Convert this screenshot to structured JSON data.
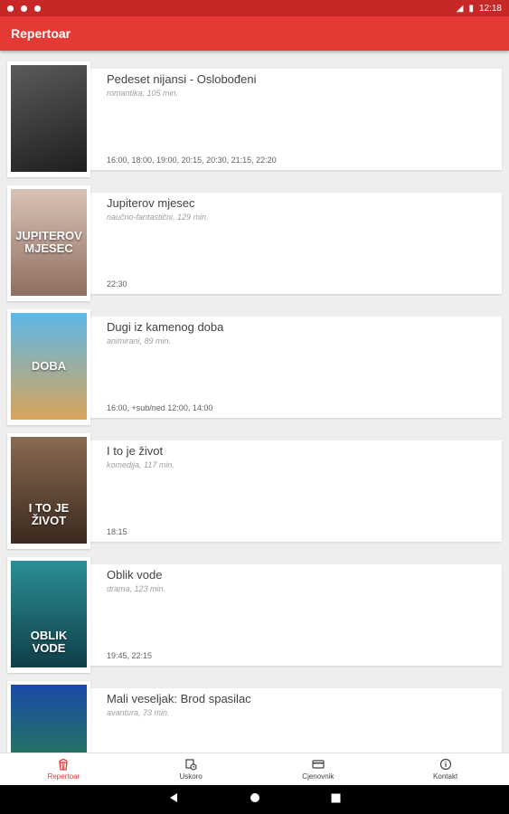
{
  "status_bar": {
    "time": "12:18"
  },
  "app_bar": {
    "title": "Repertoar"
  },
  "movies": [
    {
      "title": "Pedeset nijansi - Oslobođeni",
      "meta": "romantika, 105 min.",
      "times": "16:00, 18:00, 19:00, 20:15, 20:30, 21:15, 22:20",
      "poster_color": "#3a3a3a"
    },
    {
      "title": "Jupiterov mjesec",
      "meta": "naučno-fantastični, 129 min.",
      "times": "22:30",
      "poster_color": "#b89a8a",
      "poster_text": "JUPITEROV MJESEC"
    },
    {
      "title": "Dugi iz kamenog doba",
      "meta": "animirani, 89 min.",
      "times": "16:00, +sub/ned 12:00, 14:00",
      "poster_color": "#4aa7d8",
      "poster_text": "DOBA"
    },
    {
      "title": "I to je život",
      "meta": "komedija, 117 min.",
      "times": "18:15",
      "poster_color": "#6b4a35",
      "poster_text": "I TO JE ŽIVOT"
    },
    {
      "title": "Oblik vode",
      "meta": "drama, 123 min.",
      "times": "19:45, 22:15",
      "poster_color": "#1f6f7a",
      "poster_text": "OBLIK VODE"
    },
    {
      "title": "Mali veseljak: Brod spasilac",
      "meta": "avantura, 73 min.",
      "times": "",
      "poster_color": "#1a3d8a"
    }
  ],
  "bottom_nav": [
    {
      "label": "Repertoar",
      "icon": "popcorn-icon",
      "active": true
    },
    {
      "label": "Uskoro",
      "icon": "calendar-clock-icon",
      "active": false
    },
    {
      "label": "Cjenovnik",
      "icon": "credit-card-icon",
      "active": false
    },
    {
      "label": "Kontakt",
      "icon": "info-icon",
      "active": false
    }
  ],
  "colors": {
    "primary": "#e53935",
    "primary_dark": "#c62828",
    "active_nav": "#e53935"
  }
}
